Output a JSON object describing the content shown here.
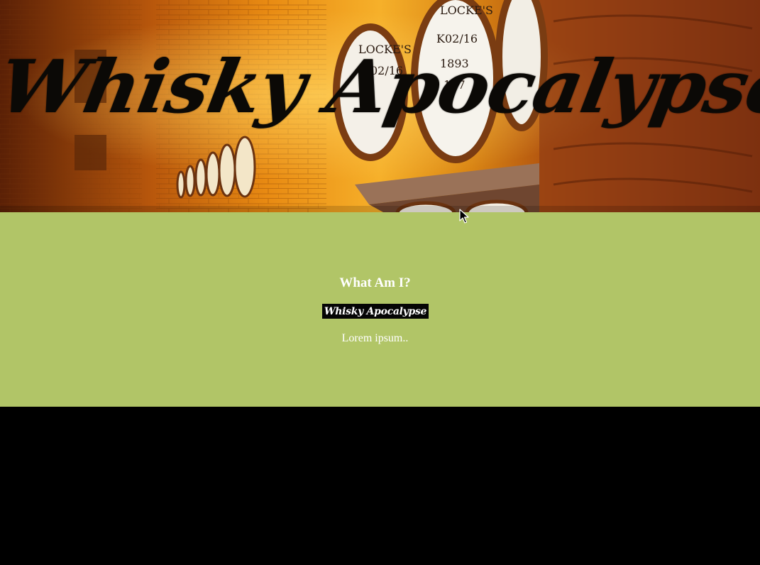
{
  "hero": {
    "title": "Whisky Apocalypse",
    "image": "whisky-barrels-cellar-photo"
  },
  "about": {
    "heading": "What Am I?",
    "logo_text": "Whisky Apocalypse",
    "body": "Lorem ipsum.."
  },
  "colors": {
    "content_background": "#b1c567",
    "footer_background": "#000000",
    "text": "#ffffff",
    "hero_tint": "#b8620f"
  }
}
